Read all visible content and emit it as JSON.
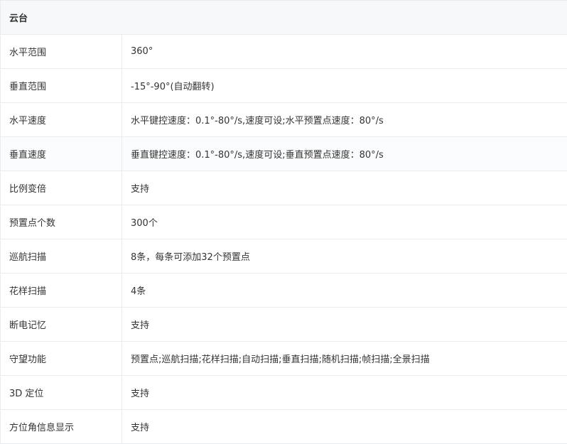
{
  "section": {
    "title": "云台"
  },
  "rows": [
    {
      "label": "水平范围",
      "value": "360°"
    },
    {
      "label": "垂直范围",
      "value": "-15°-90°(自动翻转)"
    },
    {
      "label": "水平速度",
      "value": "水平键控速度：0.1°-80°/s,速度可设;水平预置点速度：80°/s"
    },
    {
      "label": "垂直速度",
      "value": "垂直键控速度：0.1°-80°/s,速度可设;垂直预置点速度：80°/s"
    },
    {
      "label": "比例变倍",
      "value": "支持"
    },
    {
      "label": "预置点个数",
      "value": "300个"
    },
    {
      "label": "巡航扫描",
      "value": "8条，每条可添加32个预置点"
    },
    {
      "label": "花样扫描",
      "value": "4条"
    },
    {
      "label": "断电记忆",
      "value": "支持"
    },
    {
      "label": "守望功能",
      "value": "预置点;巡航扫描;花样扫描;自动扫描;垂直扫描;随机扫描;帧扫描;全景扫描"
    },
    {
      "label": "3D 定位",
      "value": "支持"
    },
    {
      "label": "方位角信息显示",
      "value": "支持"
    }
  ]
}
